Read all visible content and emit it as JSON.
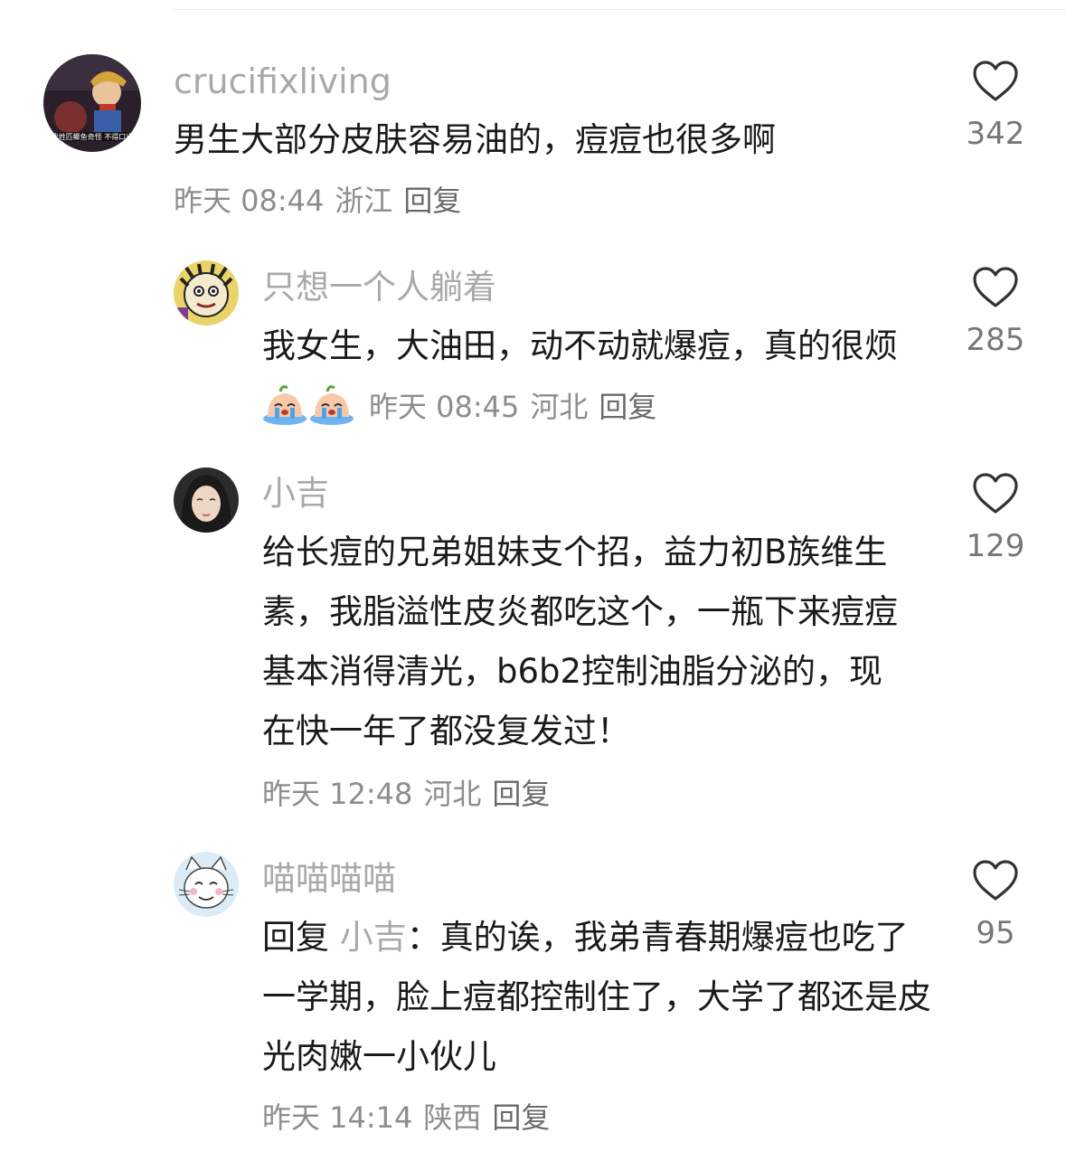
{
  "comments": [
    {
      "username": "crucifixliving",
      "text": "男生大部分皮肤容易油的，痘痘也很多啊",
      "time": "昨天 08:44",
      "location": "浙江",
      "reply_label": "回复",
      "likes": "342",
      "avatar_caption": "我姓匹鲫鱼奇怪 不得口出"
    },
    {
      "username": "只想一个人躺着",
      "text": "我女生，大油田，动不动就爆痘，真的很烦",
      "emojis": [
        "crying-emoji",
        "crying-emoji"
      ],
      "time": "昨天 08:45",
      "location": "河北",
      "reply_label": "回复",
      "likes": "285"
    },
    {
      "username": "小吉",
      "text": "给长痘的兄弟姐妹支个招，益力初B族维生素，我脂溢性皮炎都吃这个，一瓶下来痘痘基本消得清光，b6b2控制油脂分泌的，现在快一年了都没复发过！",
      "time": "昨天 12:48",
      "location": "河北",
      "reply_label": "回复",
      "likes": "129"
    },
    {
      "username": "喵喵喵喵",
      "reply_prefix": "回复",
      "reply_to": "小吉",
      "text": "：真的诶，我弟青春期爆痘也吃了一学期，脸上痘都控制住了，大学了都还是皮光肉嫩一小伙儿",
      "time": "昨天 14:14",
      "location": "陕西",
      "reply_label": "回复",
      "likes": "95"
    }
  ],
  "icons": {
    "like": "heart-outline-icon"
  },
  "colors": {
    "username": "#a9a9a9",
    "text": "#1a1a1a",
    "meta": "#8d8d8d"
  }
}
